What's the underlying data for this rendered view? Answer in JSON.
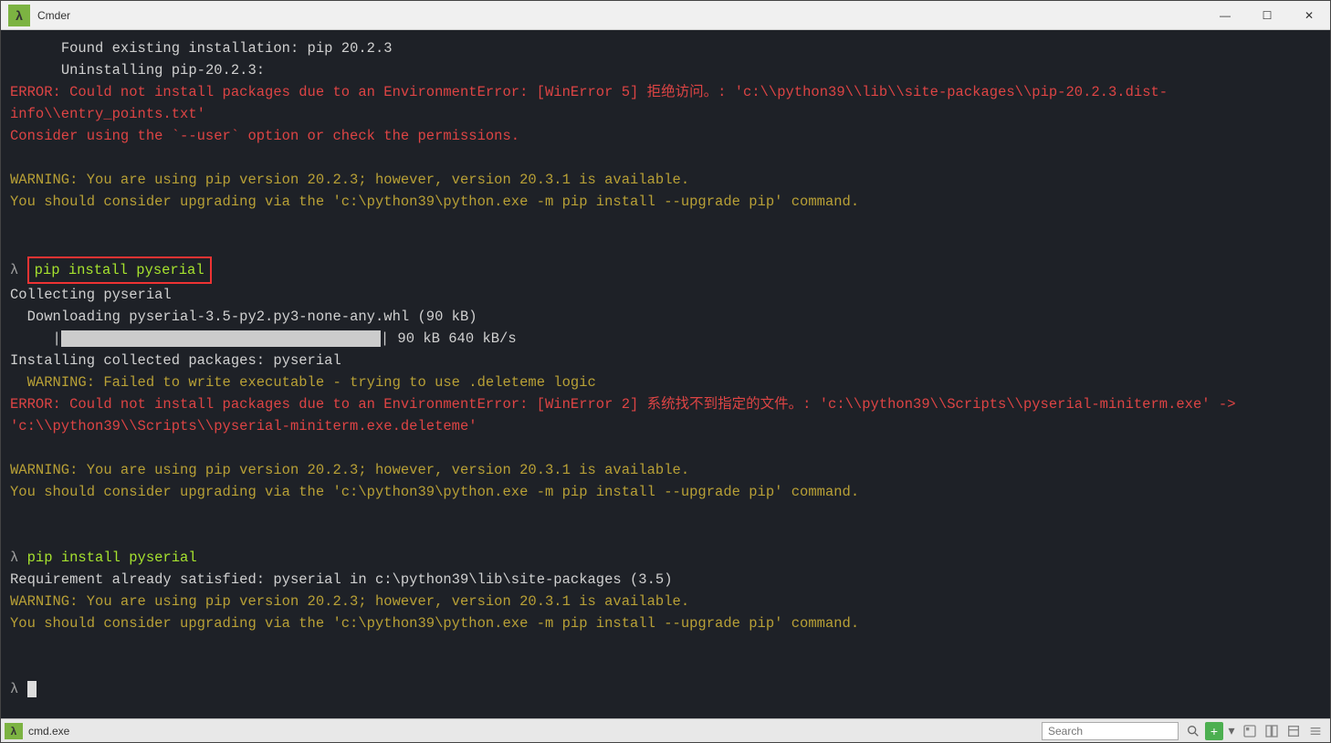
{
  "titlebar": {
    "icon_text": "λ",
    "title": "Cmder",
    "minimize": "—",
    "maximize": "☐",
    "close": "✕"
  },
  "terminal": {
    "lines": [
      {
        "cls": "white",
        "indent": "      ",
        "text": "Found existing installation: pip 20.2.3"
      },
      {
        "cls": "white",
        "indent": "      ",
        "text": "Uninstalling pip-20.2.3:"
      },
      {
        "cls": "red",
        "text": "ERROR: Could not install packages due to an EnvironmentError: [WinError 5] 拒绝访问。: 'c:\\\\python39\\\\lib\\\\site-packages\\\\pip-20.2.3.dist-info\\\\entry_points.txt'"
      },
      {
        "cls": "red",
        "text": "Consider using the `--user` option or check the permissions."
      },
      {
        "cls": "",
        "text": " "
      },
      {
        "cls": "yellow",
        "text": "WARNING: You are using pip version 20.2.3; however, version 20.3.1 is available."
      },
      {
        "cls": "yellow",
        "text": "You should consider upgrading via the 'c:\\python39\\python.exe -m pip install --upgrade pip' command."
      },
      {
        "cls": "",
        "text": " "
      },
      {
        "cls": "",
        "text": " "
      },
      {
        "cls": "prompt-boxed",
        "prompt": "λ ",
        "cmd": "pip install pyserial"
      },
      {
        "cls": "white",
        "text": "Collecting pyserial"
      },
      {
        "cls": "white",
        "text": "  Downloading pyserial-3.5-py2.py3-none-any.whl (90 kB)"
      },
      {
        "cls": "progress",
        "prefix": "     |",
        "barwidth": "350px",
        "suffix": "| 90 kB 640 kB/s"
      },
      {
        "cls": "white",
        "text": "Installing collected packages: pyserial"
      },
      {
        "cls": "yellow",
        "text": "  WARNING: Failed to write executable - trying to use .deleteme logic"
      },
      {
        "cls": "red",
        "text": "ERROR: Could not install packages due to an EnvironmentError: [WinError 2] 系统找不到指定的文件。: 'c:\\\\python39\\\\Scripts\\\\pyserial-miniterm.exe' -> 'c:\\\\python39\\\\Scripts\\\\pyserial-miniterm.exe.deleteme'"
      },
      {
        "cls": "",
        "text": " "
      },
      {
        "cls": "yellow",
        "text": "WARNING: You are using pip version 20.2.3; however, version 20.3.1 is available."
      },
      {
        "cls": "yellow",
        "text": "You should consider upgrading via the 'c:\\python39\\python.exe -m pip install --upgrade pip' command."
      },
      {
        "cls": "",
        "text": " "
      },
      {
        "cls": "",
        "text": " "
      },
      {
        "cls": "prompt",
        "prompt": "λ ",
        "cmd": "pip install pyserial"
      },
      {
        "cls": "white",
        "text": "Requirement already satisfied: pyserial in c:\\python39\\lib\\site-packages (3.5)"
      },
      {
        "cls": "yellow",
        "text": "WARNING: You are using pip version 20.2.3; however, version 20.3.1 is available."
      },
      {
        "cls": "yellow",
        "text": "You should consider upgrading via the 'c:\\python39\\python.exe -m pip install --upgrade pip' command."
      },
      {
        "cls": "",
        "text": " "
      },
      {
        "cls": "",
        "text": " "
      },
      {
        "cls": "prompt-cursor",
        "prompt": "λ "
      }
    ]
  },
  "statusbar": {
    "icon_text": "λ",
    "tab_label": "cmd.exe",
    "search_placeholder": "Search"
  },
  "toolbar": {
    "plus": "+",
    "dropdown": "▾"
  }
}
